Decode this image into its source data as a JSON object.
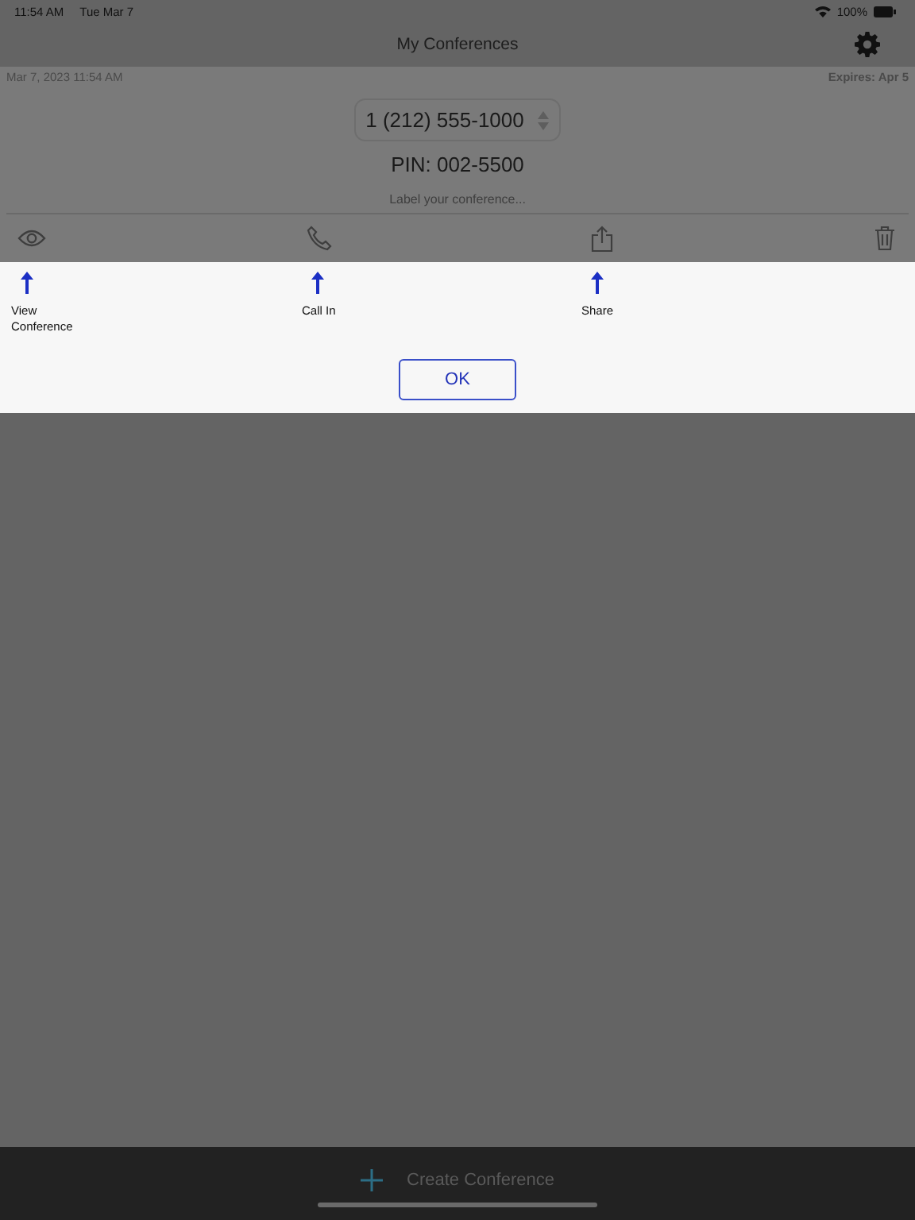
{
  "status_bar": {
    "time": "11:54 AM",
    "date": "Tue Mar 7",
    "battery": "100%"
  },
  "nav": {
    "title": "My Conferences"
  },
  "conference": {
    "created": "Mar 7, 2023 11:54 AM",
    "expires": "Expires: Apr 5",
    "phone": "1 (212) 555-1000",
    "pin": "PIN: 002-5500",
    "label": {
      "placeholder": "Label your conference..."
    }
  },
  "actions": [
    {
      "kind": "view"
    },
    {
      "kind": "call"
    },
    {
      "kind": "share"
    },
    {
      "kind": "delete"
    }
  ],
  "tips": [
    {
      "label": "View Conference"
    },
    {
      "label": "Call In"
    },
    {
      "label": "Share"
    }
  ],
  "ok_button": "OK",
  "bottom_bar": {
    "create": "Create Conference"
  }
}
